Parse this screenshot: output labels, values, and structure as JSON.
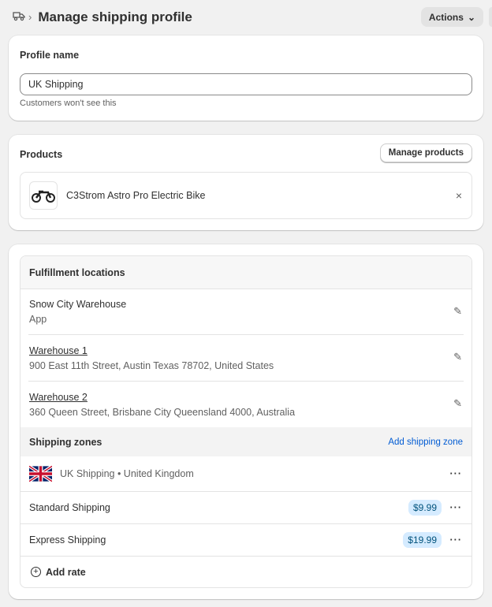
{
  "header": {
    "title": "Manage shipping profile",
    "actions_label": "Actions"
  },
  "profile": {
    "heading": "Profile name",
    "value": "UK Shipping",
    "help": "Customers won't see this"
  },
  "products": {
    "heading": "Products",
    "manage_label": "Manage products",
    "items": [
      {
        "name": "C3Strom Astro Pro Electric Bike"
      }
    ]
  },
  "fulfillment": {
    "heading": "Fulfillment locations",
    "locations": [
      {
        "name": "Snow City Warehouse",
        "detail": "App"
      },
      {
        "name": "Warehouse 1",
        "detail": "900 East 11th Street, Austin Texas 78702, United States"
      },
      {
        "name": "Warehouse 2",
        "detail": "360 Queen Street, Brisbane City Queensland 4000, Australia"
      }
    ]
  },
  "zones": {
    "heading": "Shipping zones",
    "add_label": "Add shipping zone",
    "zone": "UK Shipping • United Kingdom",
    "rates": [
      {
        "name": "Standard Shipping",
        "price": "$9.99"
      },
      {
        "name": "Express Shipping",
        "price": "$19.99"
      }
    ],
    "add_rate_label": "Add rate"
  }
}
